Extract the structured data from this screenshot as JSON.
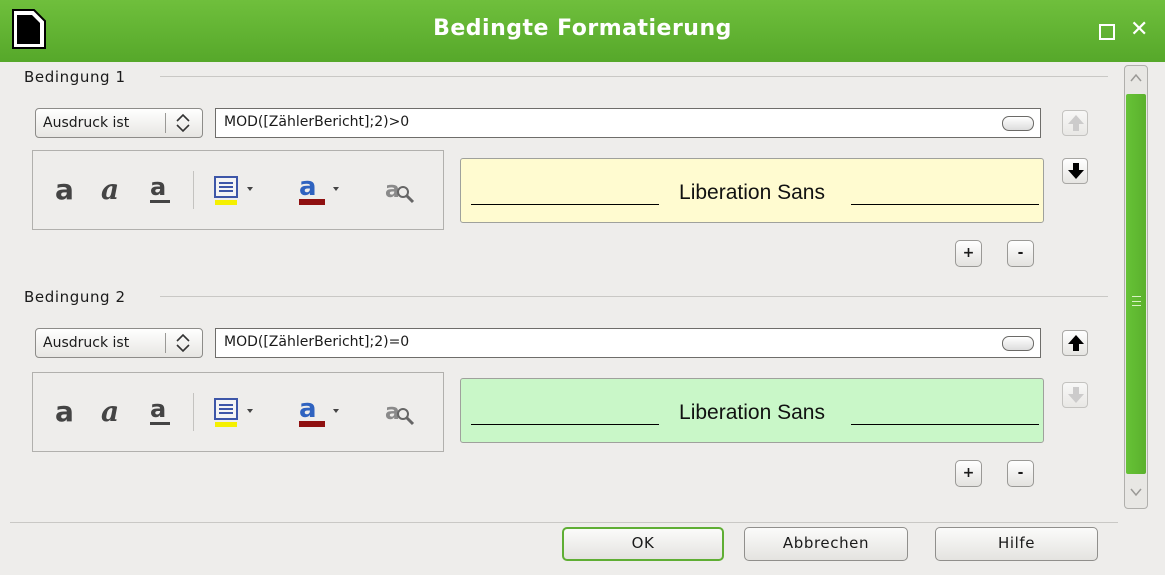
{
  "window": {
    "title": "Bedingte Formatierung",
    "accent_color": "#5aab2e"
  },
  "conditions": [
    {
      "title": "Bedingung 1",
      "type_label": "Ausdruck ist",
      "expression": "MOD([ZählerBericht];2)>0",
      "preview_text": "Liberation Sans",
      "preview_bg": "#fffbd0",
      "move_up_enabled": false,
      "move_down_enabled": true,
      "add_label": "+",
      "remove_label": "-"
    },
    {
      "title": "Bedingung 2",
      "type_label": "Ausdruck ist",
      "expression": "MOD([ZählerBericht];2)=0",
      "preview_text": "Liberation Sans",
      "preview_bg": "#c9f7c8",
      "move_up_enabled": true,
      "move_down_enabled": false,
      "add_label": "+",
      "remove_label": "-"
    }
  ],
  "buttons": {
    "ok": "OK",
    "cancel": "Abbrechen",
    "help": "Hilfe"
  },
  "toolbar_icons": [
    "bold-icon",
    "italic-icon",
    "underline-icon",
    "background-color-icon",
    "font-color-icon",
    "more-options-icon"
  ]
}
